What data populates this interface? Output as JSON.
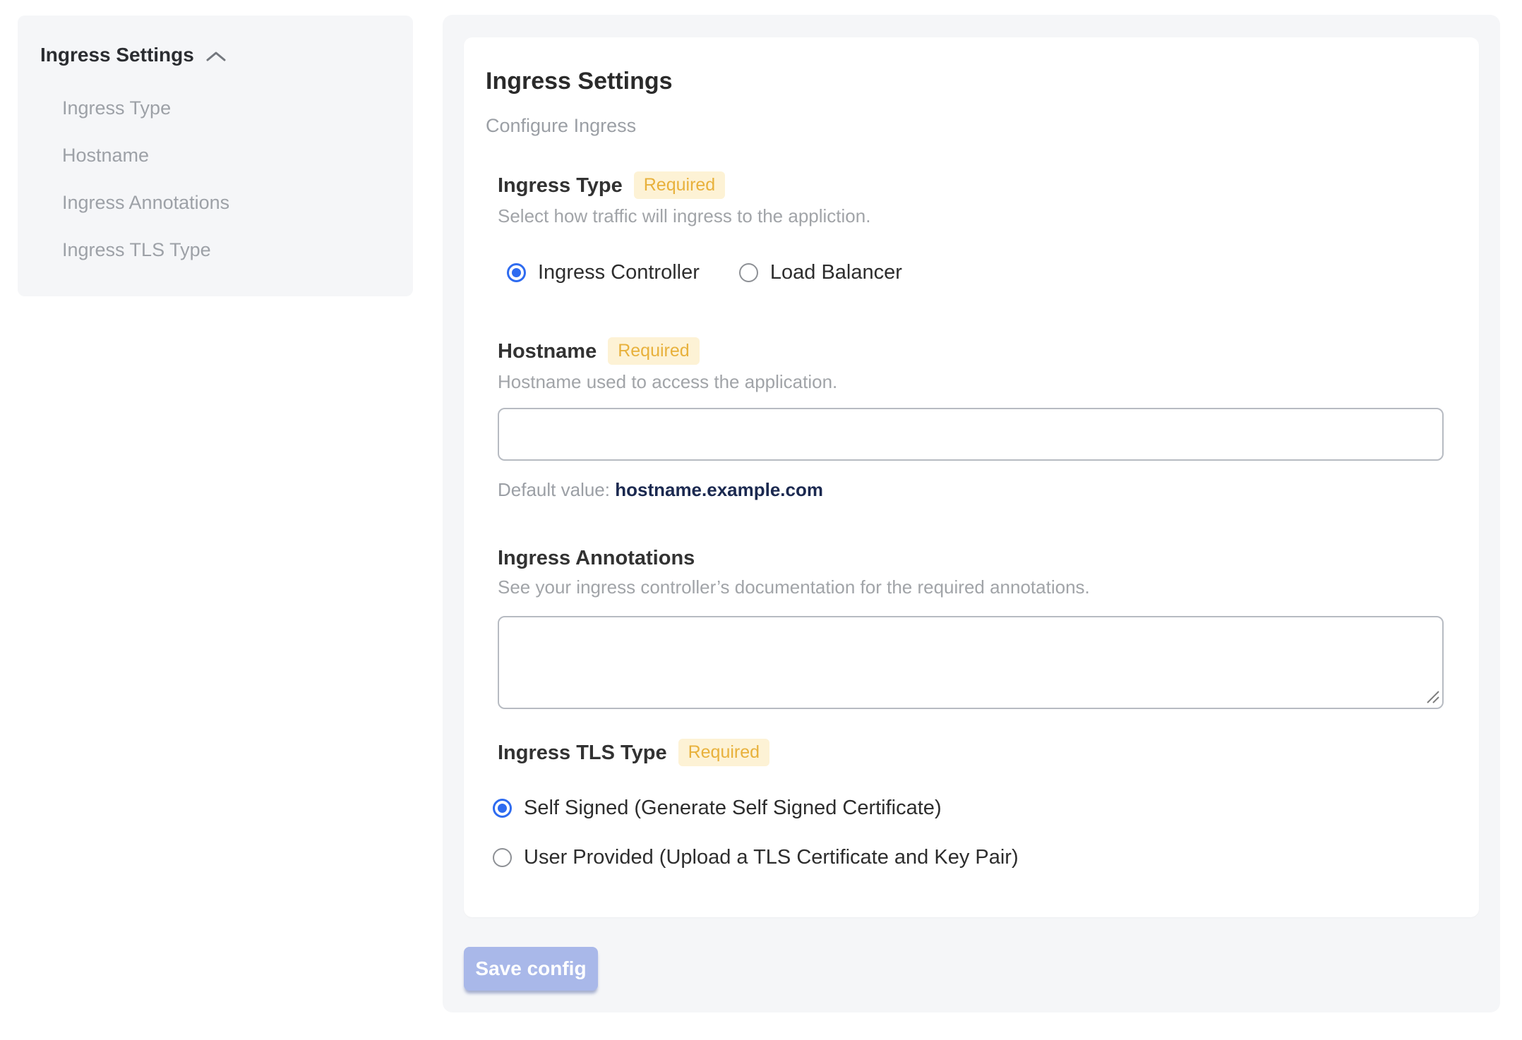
{
  "colors": {
    "page_background": "#ffffff",
    "panel_background": "#f5f6f8",
    "card_background": "#ffffff",
    "accent_blue": "#2e6bf0",
    "badge_background": "#fdf2d5",
    "badge_text": "#e8b13c",
    "default_value_text": "#1b2950",
    "muted_text": "#9b9fa5",
    "dark_text": "#2a2a2a",
    "input_border": "#b7bbc2",
    "save_button_background": "#a9b8e9"
  },
  "sidebar": {
    "title": "Ingress Settings",
    "collapse_icon": "chevron-up",
    "items": [
      {
        "label": "Ingress Type"
      },
      {
        "label": "Hostname"
      },
      {
        "label": "Ingress Annotations"
      },
      {
        "label": "Ingress TLS Type"
      }
    ]
  },
  "main": {
    "title": "Ingress Settings",
    "subtitle": "Configure Ingress",
    "required_badge": "Required",
    "sections": {
      "ingress_type": {
        "label": "Ingress Type",
        "required": true,
        "description": "Select how traffic will ingress to the appliction.",
        "options": [
          {
            "label": "Ingress Controller",
            "selected": true
          },
          {
            "label": "Load Balancer",
            "selected": false
          }
        ]
      },
      "hostname": {
        "label": "Hostname",
        "required": true,
        "description": "Hostname used to access the application.",
        "value": "",
        "default_label": "Default value:",
        "default_value": "hostname.example.com"
      },
      "annotations": {
        "label": "Ingress Annotations",
        "required": false,
        "description": "See your ingress controller’s documentation for the required annotations.",
        "value": ""
      },
      "tls": {
        "label": "Ingress TLS Type",
        "required": true,
        "options": [
          {
            "label": "Self Signed (Generate Self Signed Certificate)",
            "selected": true
          },
          {
            "label": "User Provided (Upload a TLS Certificate and Key Pair)",
            "selected": false
          }
        ]
      }
    },
    "save_button_label": "Save config"
  }
}
